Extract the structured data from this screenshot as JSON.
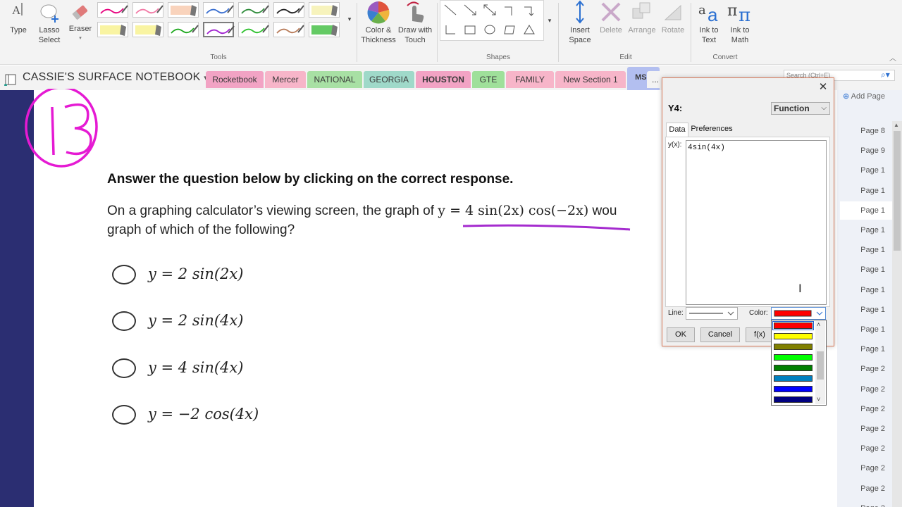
{
  "ribbon": {
    "type_label": "Type",
    "lasso_label1": "Lasso",
    "lasso_label2": "Select",
    "eraser_label": "Eraser",
    "color_label1": "Color &",
    "color_label2": "Thickness",
    "draw_label1": "Draw with",
    "draw_label2": "Touch",
    "insert_label1": "Insert",
    "insert_label2": "Space",
    "delete_label": "Delete",
    "arrange_label": "Arrange",
    "rotate_label": "Rotate",
    "inktext_label1": "Ink to",
    "inktext_label2": "Text",
    "inkmath_label1": "Ink to",
    "inkmath_label2": "Math",
    "group_tools": "Tools",
    "group_shapes": "Shapes",
    "group_edit": "Edit",
    "group_convert": "Convert",
    "pen_colors_row1": [
      "#e6007e",
      "#f27aa6",
      "#f7c0a0",
      "#3a6fd0",
      "#2e8b3a",
      "#222222",
      "#f4eea0"
    ],
    "pen_colors_row2": [
      "#f6f07a",
      "#f6f07a",
      "#1fa81f",
      "#a020d0",
      "#2ec02e",
      "#b87c5a",
      "#22b422"
    ]
  },
  "notebook": {
    "title": "CASSIE'S SURFACE NOTEBOOK",
    "search_placeholder": "Search (Ctrl+E)",
    "tabs": [
      {
        "label": "Rocketbook",
        "color": "#f2a3c4"
      },
      {
        "label": "Mercer",
        "color": "#f7b5c9"
      },
      {
        "label": "NATIONAL",
        "color": "#a8e0a4"
      },
      {
        "label": "GEORGIA",
        "color": "#9fd9c9"
      },
      {
        "label": "HOUSTON",
        "color": "#f2a3c4"
      },
      {
        "label": "GTE",
        "color": "#9fe09a"
      },
      {
        "label": "FAMILY",
        "color": "#f7b5c9"
      },
      {
        "label": "New Section 1",
        "color": "#f7b5c9"
      },
      {
        "label": "MSP",
        "color": "#b3bff0"
      }
    ],
    "more_tabs": "..."
  },
  "question": {
    "annotation": "13",
    "heading": "Answer the question below by clicking on the correct response.",
    "body_prefix": "On a graphing calculator’s viewing screen, the graph of ",
    "body_formula": "y = 4 sin(2x) cos(−2x)",
    "body_suffix": " wou",
    "body_line2": "graph of which of the following?",
    "options": [
      "y = 2 sin(2x)",
      "y = 2 sin(4x)",
      "y = 4 sin(4x)",
      "y = −2 cos(4x)"
    ]
  },
  "pages": {
    "add_page": "Add Page",
    "items": [
      "Page 8",
      "Page 9",
      "Page 1",
      "Page 1",
      "Page 1",
      "Page 1",
      "Page 1",
      "Page 1",
      "Page 1",
      "Page 1",
      "Page 1",
      "Page 1",
      "Page 2",
      "Page 2",
      "Page 2",
      "Page 2",
      "Page 2",
      "Page 2",
      "Page 2",
      "Page 2"
    ]
  },
  "dialog": {
    "title": "Y4:",
    "function_select": "Function",
    "tab_data": "Data",
    "tab_preferences": "Preferences",
    "yx_label": "y(x):",
    "yx_value": "4sin(4x)",
    "line_label": "Line:",
    "color_label": "Color:",
    "selected_color": "#ff0000",
    "ok_label": "OK",
    "cancel_label": "Cancel",
    "fx_label": "f(x)",
    "color_options": [
      "#ff0000",
      "#ffff00",
      "#808000",
      "#00ff00",
      "#008000",
      "#0080c0",
      "#0000ff",
      "#000080"
    ]
  }
}
